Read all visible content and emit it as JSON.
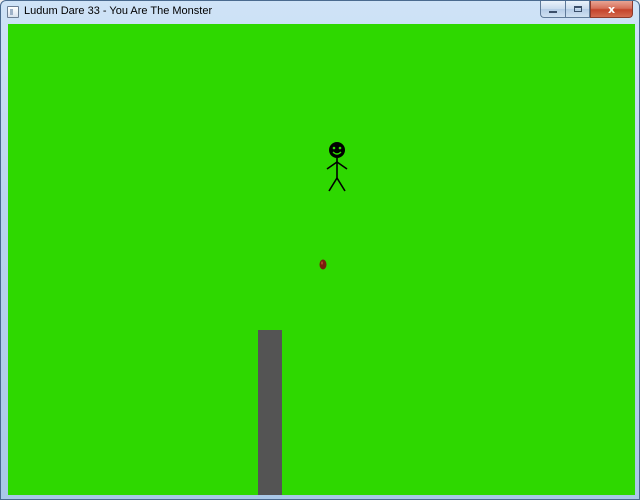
{
  "window": {
    "title": "Ludum Dare 33 - You Are The Monster",
    "icon": "app-window-icon",
    "buttons": {
      "minimize": "minimize-icon",
      "maximize": "maximize-icon",
      "close": "close-icon",
      "close_glyph": "x"
    }
  },
  "game": {
    "background_color": "#2ed800",
    "entities": [
      {
        "kind": "player",
        "icon": "stickman-icon",
        "color": "#000000"
      },
      {
        "kind": "projectile",
        "icon": "seed-icon",
        "color": "#7a1d0e"
      },
      {
        "kind": "obstacle",
        "icon": "pillar",
        "color": "#545454"
      }
    ]
  }
}
